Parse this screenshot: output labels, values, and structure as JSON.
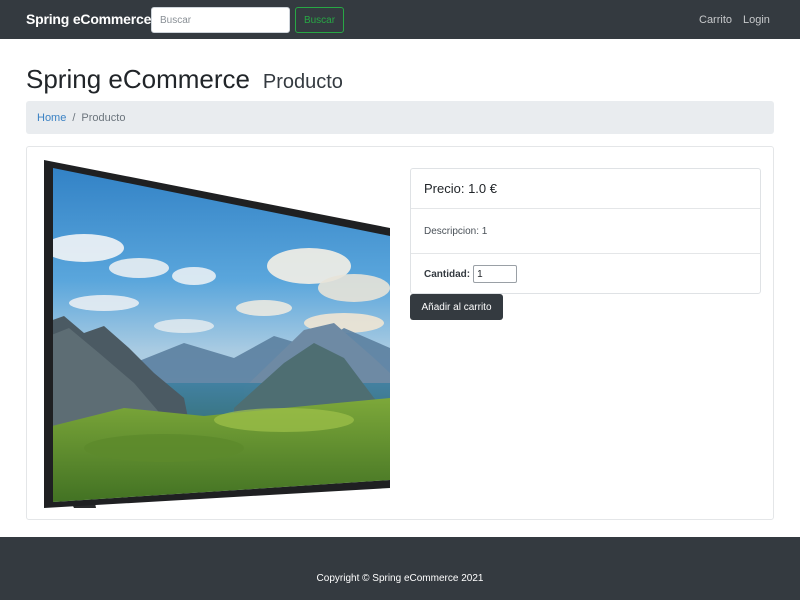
{
  "navbar": {
    "brand": "Spring eCommerce",
    "search_placeholder": "Buscar",
    "search_button": "Buscar",
    "links": [
      "Carrito",
      "Login"
    ]
  },
  "heading": {
    "main": "Spring eCommerce",
    "sub": "Producto"
  },
  "breadcrumb": {
    "home": "Home",
    "separator": "/",
    "current": "Producto"
  },
  "product": {
    "image": "flat-screen-tv-landscape",
    "price": "Precio: 1.0 €",
    "description": "Descripcion: 1",
    "quantity_label": "Cantidad:",
    "quantity_value": "1",
    "add_button": "Añadir al carrito"
  },
  "footer": {
    "text": "Copyright © Spring eCommerce 2021"
  },
  "colors": {
    "navbar_bg": "#343a40",
    "search_accent": "#28a745",
    "link_accent": "#3b82c4",
    "breadcrumb_bg": "#e9ecef"
  }
}
